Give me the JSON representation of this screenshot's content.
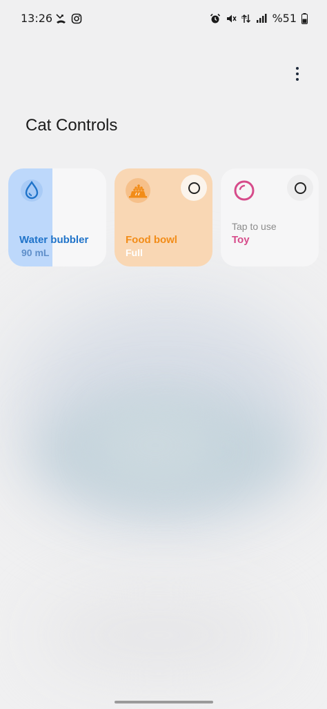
{
  "status_bar": {
    "time": "13:26",
    "battery_text": "%51",
    "left_icons": [
      "missed-call-icon",
      "instagram-icon"
    ],
    "right_icons": [
      "alarm-icon",
      "mute-icon",
      "data-arrows-icon",
      "signal-icon",
      "battery-icon"
    ]
  },
  "header": {
    "title": "Cat Controls",
    "more_icon": "more-vertical-icon"
  },
  "tiles": [
    {
      "icon": "water-drop-icon",
      "label": "Water bubbler",
      "value": "90 mL",
      "fill_fraction": 0.45,
      "accent": "#1f73c9"
    },
    {
      "icon": "food-bowl-icon",
      "label": "Food bowl",
      "value": "Full",
      "accent": "#f28c18"
    },
    {
      "icon": "ball-toy-icon",
      "status": "Tap to use",
      "label": "Toy",
      "accent": "#d64b8a"
    }
  ]
}
